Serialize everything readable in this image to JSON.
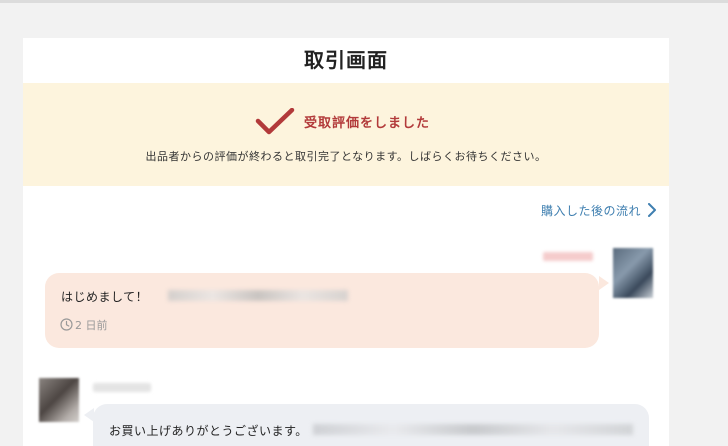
{
  "page": {
    "title": "取引画面"
  },
  "notice": {
    "heading": "受取評価をしました",
    "body": "出品者からの評価が終わると取引完了となります。しばらくお待ちください。",
    "icon": "checkmark-icon",
    "accent": "#b23a3a",
    "background": "#fdf4dd"
  },
  "flow_link": {
    "label": "購入した後の流れ",
    "icon": "chevron-right-icon",
    "color": "#3f7fb0"
  },
  "messages": [
    {
      "side": "right",
      "text": "はじめまして！",
      "time": "2 日前",
      "time_icon": "clock-icon",
      "bubble_color": "#fbe8de"
    },
    {
      "side": "left",
      "text": "お買い上げありがとうございます。",
      "bubble_color": "#edeff3"
    }
  ]
}
